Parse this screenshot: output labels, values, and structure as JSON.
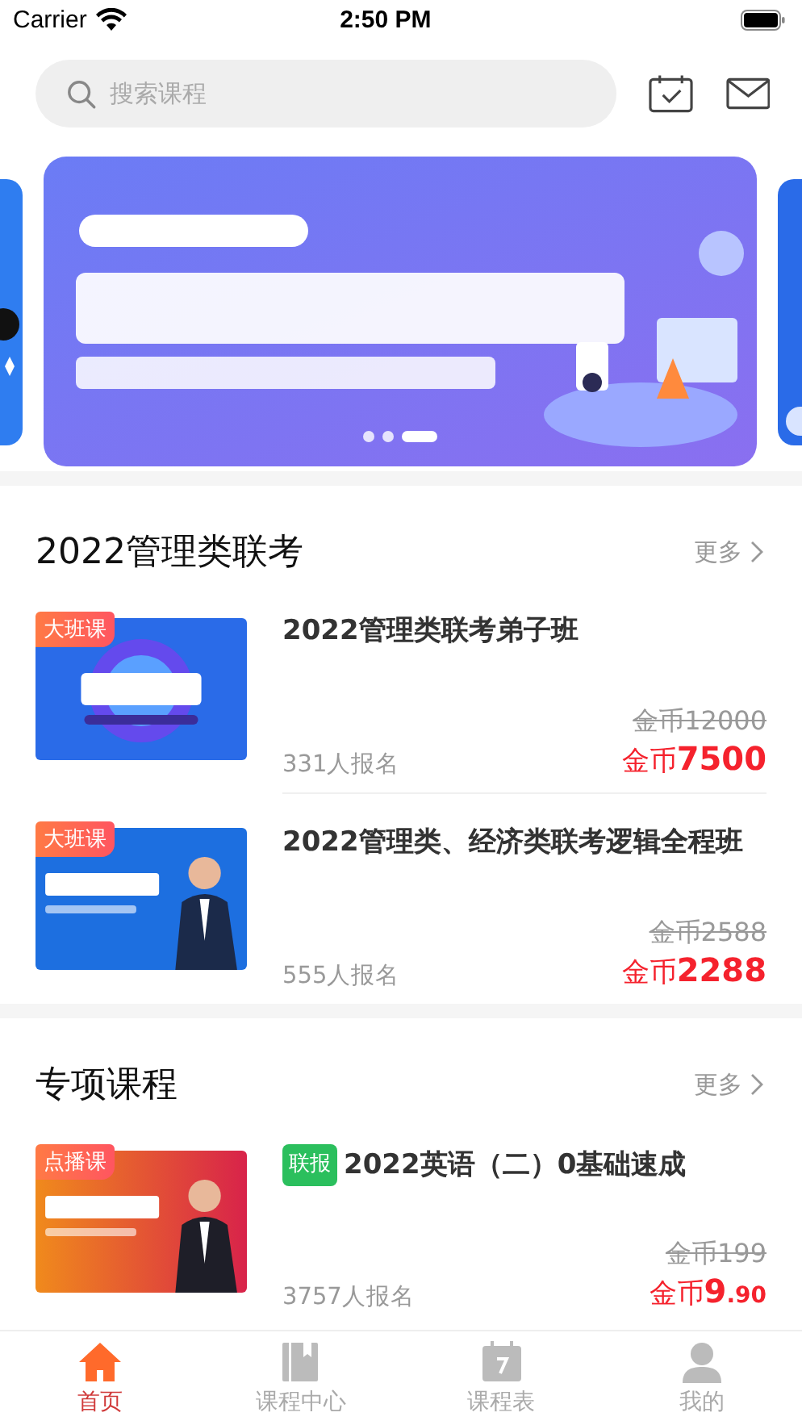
{
  "status_bar": {
    "carrier": "Carrier",
    "time": "2:50 PM"
  },
  "search": {
    "placeholder": "搜索课程"
  },
  "banner": {
    "dots": [
      {
        "selected": false
      },
      {
        "selected": false
      },
      {
        "selected": true
      }
    ]
  },
  "sections": [
    {
      "title": "2022管理类联考",
      "more": "更多",
      "courses": [
        {
          "badge": "大班课",
          "title": "2022管理类联考弟子班",
          "enrolled": "331人报名",
          "old_price": "金币12000",
          "price_currency": "金币",
          "price_amount": "7500"
        },
        {
          "badge": "大班课",
          "title": "2022管理类、经济类联考逻辑全程班",
          "enrolled": "555人报名",
          "old_price": "金币2588",
          "price_currency": "金币",
          "price_amount": "2288"
        }
      ]
    },
    {
      "title": "专项课程",
      "more": "更多",
      "courses": [
        {
          "badge": "点播课",
          "tag": "联报",
          "title": "2022英语（二）0基础速成",
          "enrolled": "3757人报名",
          "old_price": "金币199",
          "price_currency": "金币",
          "price_amount": "9",
          "price_fraction": ".90"
        }
      ]
    }
  ],
  "tab_bar": [
    {
      "label": "首页",
      "kind": "home",
      "selected": true
    },
    {
      "label": "课程中心",
      "kind": "book",
      "selected": false
    },
    {
      "label": "课程表",
      "kind": "calendar",
      "selected": false
    },
    {
      "label": "我的",
      "kind": "person",
      "selected": false
    }
  ]
}
